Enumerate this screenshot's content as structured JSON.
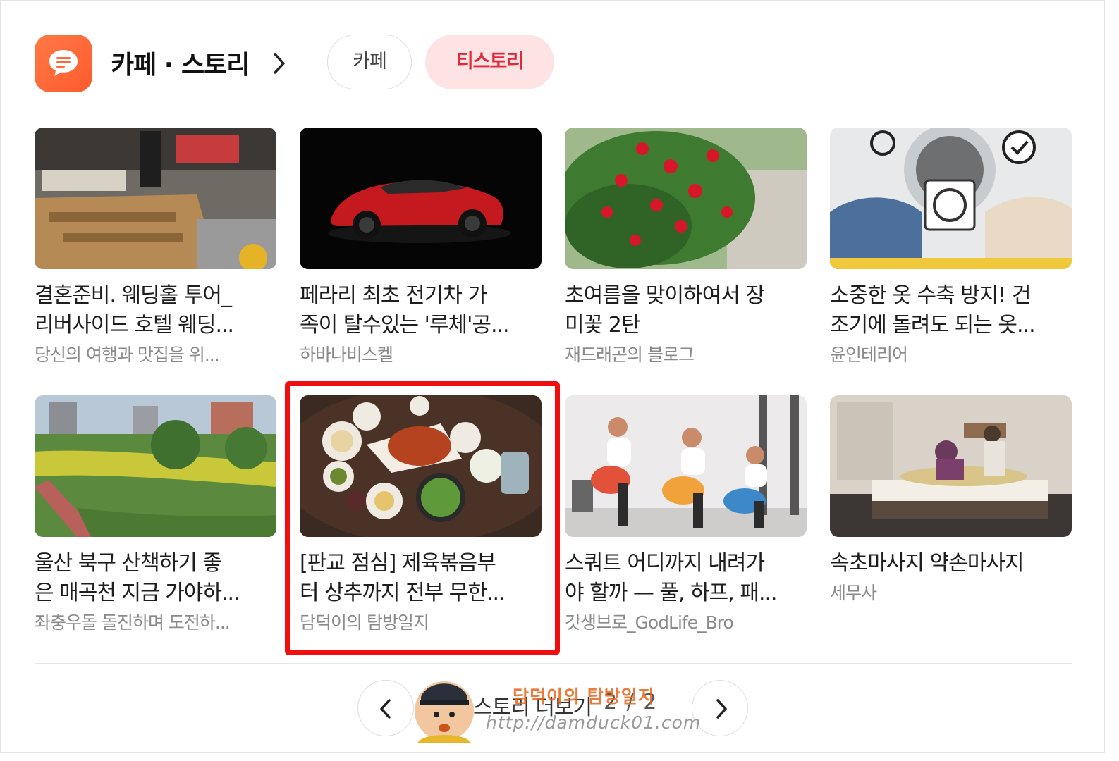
{
  "header": {
    "title": "카페 · 스토리",
    "tabs": [
      {
        "label": "카페",
        "active": false
      },
      {
        "label": "티스토리",
        "active": true
      }
    ],
    "app_icon": "chat-bubble-icon",
    "accent_color": "#ff6a3d"
  },
  "cards": [
    {
      "title_line1": "결혼준비. 웨딩홀 투어_",
      "title_line2": "리버사이드 호텔 웨딩...",
      "source": "당신의 여행과 맛집을 위...",
      "thumbnail": "kitchen-steamer"
    },
    {
      "title_line1": "페라리 최초 전기차 가",
      "title_line2": "족이 탈수있는 '루체'공...",
      "source": "하바나비스켈",
      "thumbnail": "red-sports-car"
    },
    {
      "title_line1": "초여름을 맞이하여서 장",
      "title_line2": "미꽃 2탄",
      "source": "재드래곤의 블로그",
      "thumbnail": "red-roses"
    },
    {
      "title_line1": "소중한 옷 수축 방지! 건",
      "title_line2": "조기에 돌려도 되는 옷...",
      "source": "윤인테리어",
      "thumbnail": "dryer-clothes"
    },
    {
      "title_line1": "울산 북구 산책하기 좋",
      "title_line2": "은 매곡천 지금 가야하...",
      "source": "좌충우돌 돌진하며 도전하...",
      "thumbnail": "riverside-park"
    },
    {
      "title_line1": "[판교 점심] 제육볶음부",
      "title_line2": "터 상추까지 전부 무한...",
      "source": "담덕이의 탐방일지",
      "thumbnail": "korean-lunch-table"
    },
    {
      "title_line1": "스쿼트 어디까지 내려가",
      "title_line2": "야 할까 — 풀, 하프, 패...",
      "source": "갓생브로_GodLife_Bro",
      "thumbnail": "squat-illustration"
    },
    {
      "title_line1": "속초마사지 약손마사지",
      "title_line2": "",
      "source": "세무사",
      "thumbnail": "massage-room"
    }
  ],
  "highlight_color": "#f20e0e",
  "pager": {
    "more_label": "스토리 더보기",
    "current_page": "2",
    "page_indicator": "2 / 2",
    "prev_icon": "chevron-left-icon",
    "next_icon": "chevron-right-icon"
  },
  "watermark": {
    "name": "담덕이의 탐방일지",
    "url": "http://damduck01.com"
  }
}
